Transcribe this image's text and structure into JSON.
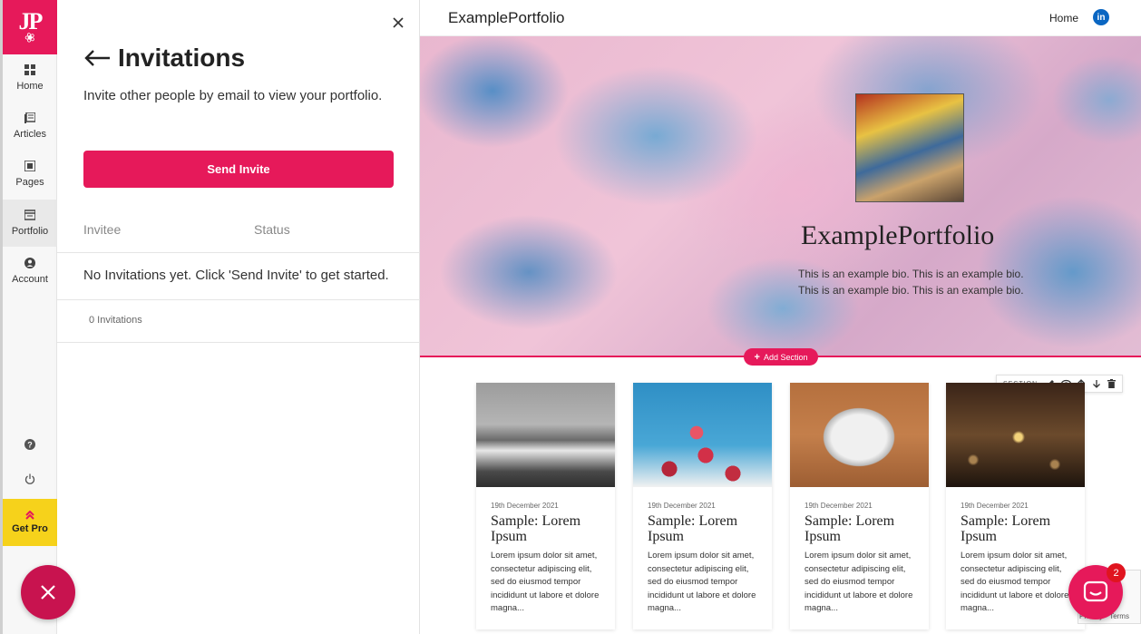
{
  "rail": {
    "logo_text": "JP",
    "items": [
      {
        "label": "Home",
        "icon": "grid-icon"
      },
      {
        "label": "Articles",
        "icon": "articles-icon"
      },
      {
        "label": "Pages",
        "icon": "pages-icon"
      },
      {
        "label": "Portfolio",
        "icon": "portfolio-icon"
      },
      {
        "label": "Account",
        "icon": "account-icon"
      }
    ],
    "help_icon": "help-icon",
    "power_icon": "power-icon",
    "get_pro_label": "Get Pro"
  },
  "panel": {
    "title": "Invitations",
    "description": "Invite other people by email to view your portfolio.",
    "send_button": "Send Invite",
    "columns": [
      "Invitee",
      "Status"
    ],
    "empty_message": "No Invitations yet. Click 'Send Invite' to get started.",
    "count_text": "0 Invitations"
  },
  "site": {
    "brand": "ExamplePortfolio",
    "nav_home": "Home",
    "linkedin_label": "in",
    "hero_title": "ExamplePortfolio",
    "hero_bio": "This is an example bio. This is an example bio. This is an example bio. This is an example bio.",
    "add_section": "Add Section",
    "section_label": "SECTION",
    "cards": [
      {
        "date": "19th December 2021",
        "title": "Sample: Lorem Ipsum",
        "excerpt": "Lorem ipsum dolor sit amet, consectetur adipiscing elit, sed do eiusmod tempor incididunt ut labore et dolore magna..."
      },
      {
        "date": "19th December 2021",
        "title": "Sample: Lorem Ipsum",
        "excerpt": "Lorem ipsum dolor sit amet, consectetur adipiscing elit, sed do eiusmod tempor incididunt ut labore et dolore magna..."
      },
      {
        "date": "19th December 2021",
        "title": "Sample: Lorem Ipsum",
        "excerpt": "Lorem ipsum dolor sit amet, consectetur adipiscing elit, sed do eiusmod tempor incididunt ut labore et dolore magna..."
      },
      {
        "date": "19th December 2021",
        "title": "Sample: Lorem Ipsum",
        "excerpt": "Lorem ipsum dolor sit amet, consectetur adipiscing elit, sed do eiusmod tempor incididunt ut labore et dolore magna..."
      }
    ]
  },
  "chat": {
    "badge": "2"
  },
  "recaptcha": {
    "text": "Privacy - Terms"
  },
  "colors": {
    "brand": "#e6195a",
    "pro": "#f6d21b",
    "linkedin": "#0a66c2"
  }
}
